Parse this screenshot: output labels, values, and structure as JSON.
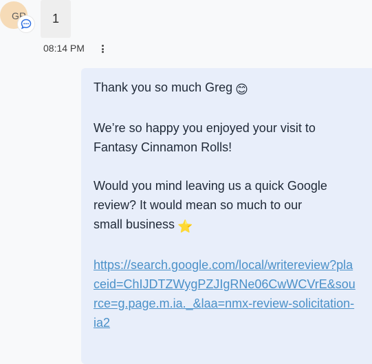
{
  "incoming": {
    "avatar_initials": "GR",
    "channel_icon": "chat-bubble-icon",
    "message_text": "1",
    "timestamp": "08:14 PM",
    "more_icon": "vertical-ellipsis-icon"
  },
  "outgoing": {
    "lines": {
      "line1": "Thank you so much Greg",
      "line2": "We’re so happy you enjoyed your visit to",
      "line3": "Fantasy Cinnamon Rolls!",
      "line4": "Would you mind leaving us a quick Google",
      "line5": "review? It would mean so much to our",
      "line6": "small business"
    },
    "emojis": {
      "smile": "😊",
      "star": "⭐"
    },
    "link": "https://search.google.com/local/writereview?placeid=ChIJDTZWygPZJIgRNe06CwWCVrE&source=g.page.m.ia._&laa=nmx-review-solicitation-ia2"
  },
  "colors": {
    "incoming_bubble": "#eeeeee",
    "outgoing_bubble": "#e8eefa",
    "link": "#4a90c8",
    "avatar_bg": "#f6dbb7",
    "badge_accent": "#2f6fe0"
  }
}
